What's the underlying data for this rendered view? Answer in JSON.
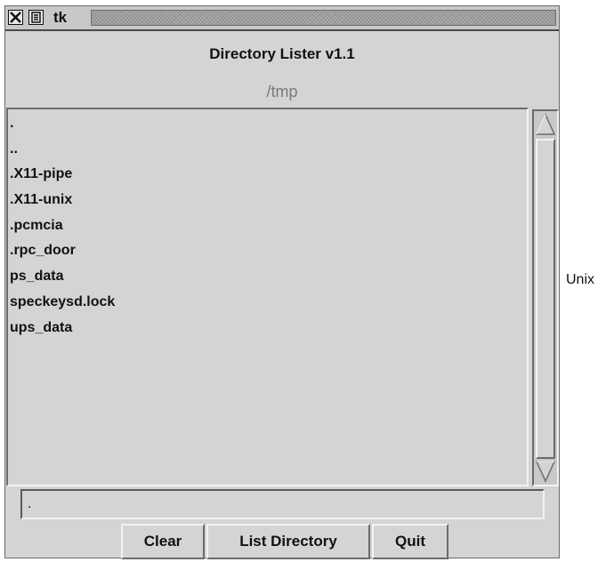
{
  "window": {
    "title": "tk",
    "title_icons": [
      "close-icon",
      "menu-icon"
    ]
  },
  "app": {
    "title": "Directory Lister v1.1",
    "current_directory": "/tmp"
  },
  "listbox": {
    "items": [
      ".",
      "..",
      ".X11-pipe",
      ".X11-unix",
      ".pcmcia",
      ".rpc_door",
      "ps_data",
      "speckeysd.lock",
      "ups_data"
    ]
  },
  "scrollbar": {
    "icons": [
      "scroll-up-arrow-icon",
      "scroll-down-arrow-icon"
    ]
  },
  "entry": {
    "value": "."
  },
  "buttons": {
    "clear": "Clear",
    "list_directory": "List Directory",
    "quit": "Quit"
  },
  "caption": {
    "text": "Unix"
  },
  "colors": {
    "background": "#d4d4d4",
    "directory_label": "#7a7a7a",
    "text": "#111111"
  }
}
